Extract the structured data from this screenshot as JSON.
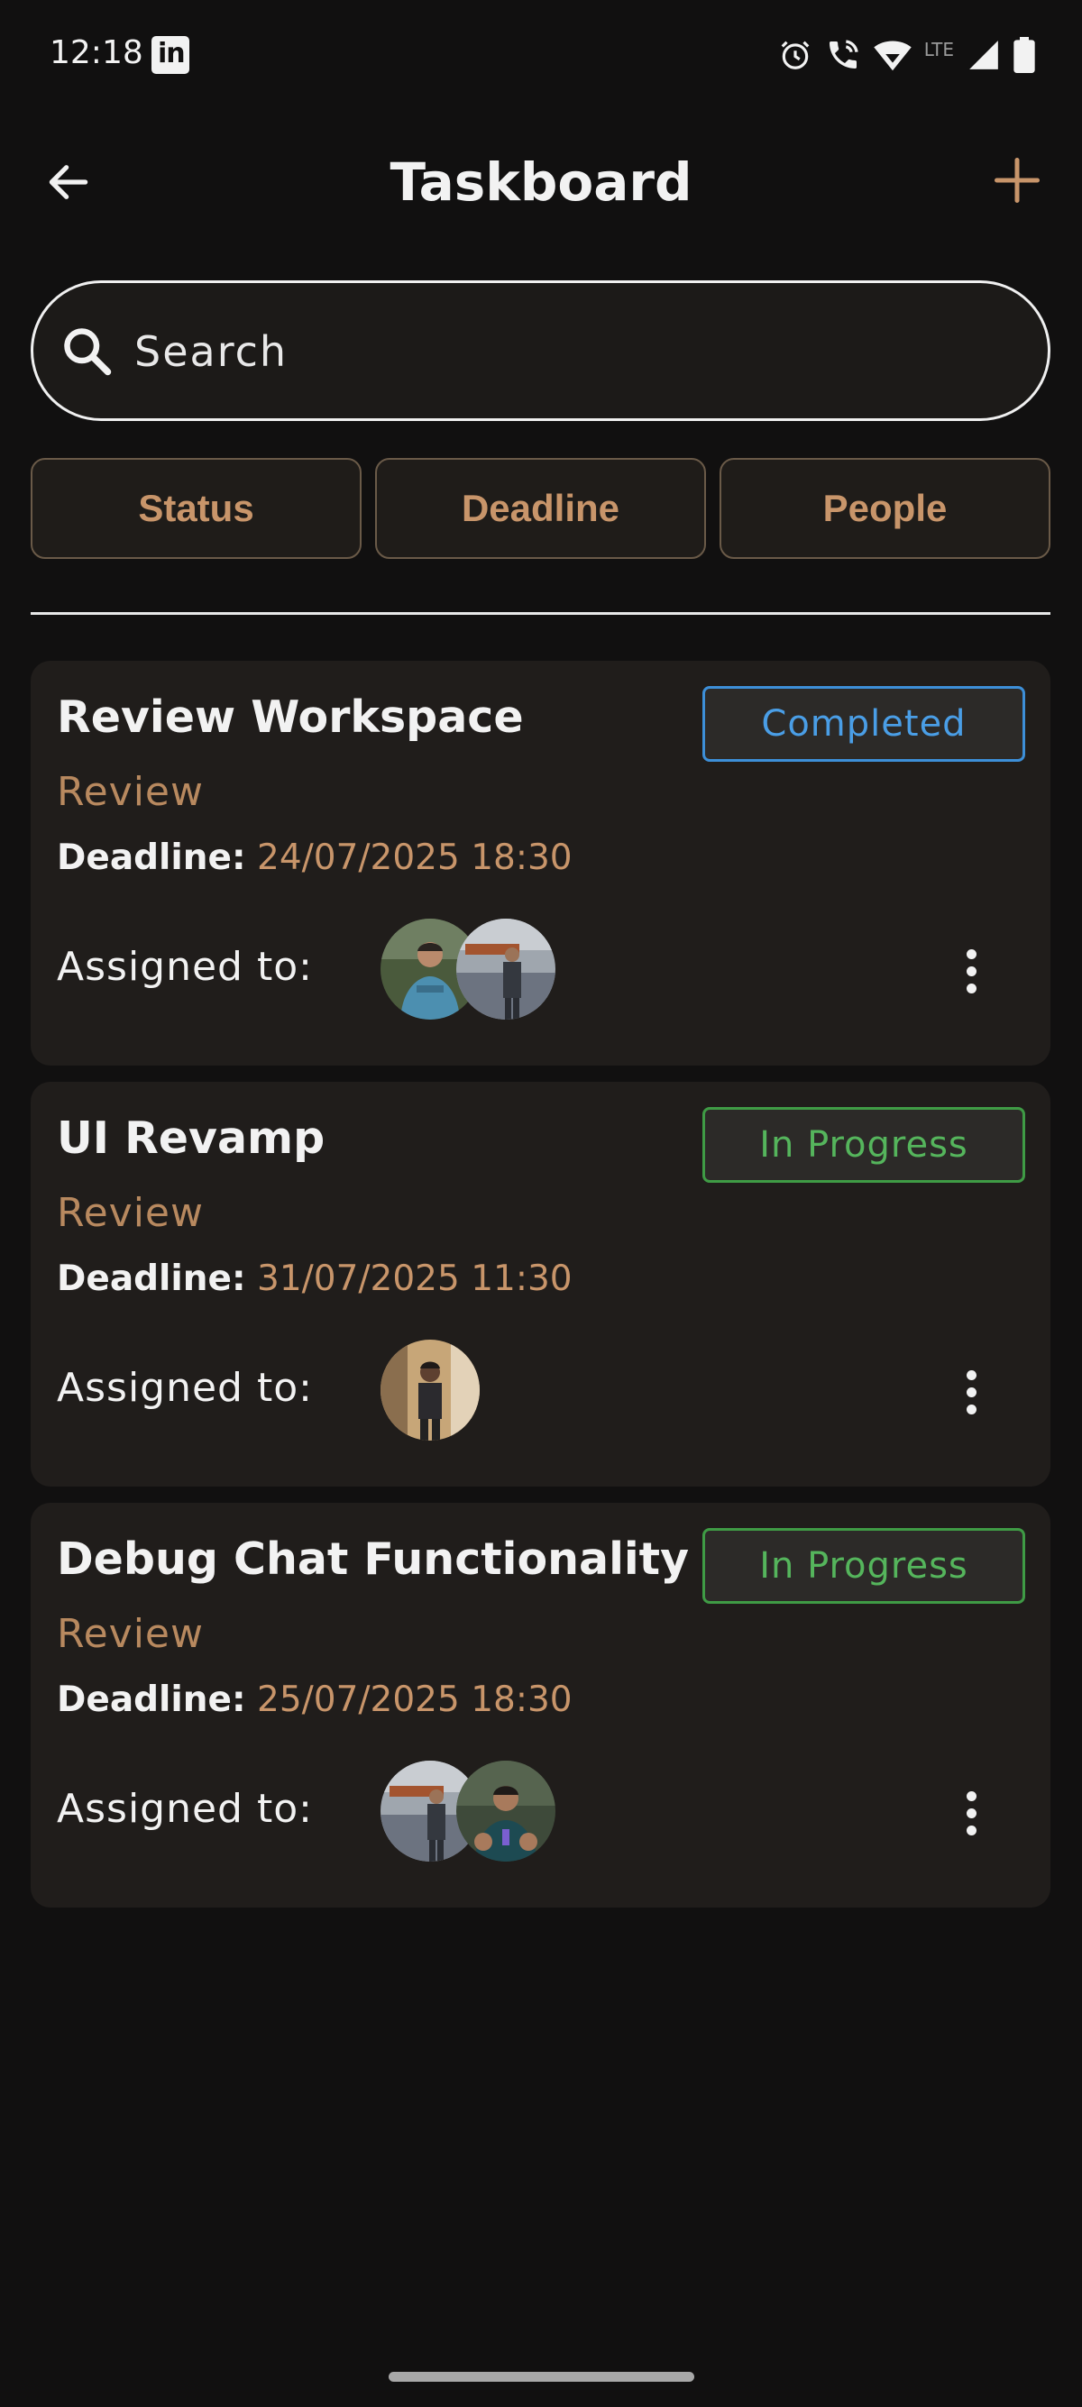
{
  "status_bar": {
    "time": "12:18",
    "lte": "LTE"
  },
  "header": {
    "title": "Taskboard",
    "back_icon": "arrow-left-icon",
    "add_icon": "plus-icon"
  },
  "search": {
    "placeholder": "Search"
  },
  "filters": {
    "status": "Status",
    "deadline": "Deadline",
    "people": "People"
  },
  "tasks": [
    {
      "title": "Review Workspace",
      "status": "Completed",
      "category": "Review",
      "deadline_label": "Deadline:",
      "deadline": "24/07/2025 18:30",
      "assigned_label": "Assigned to:"
    },
    {
      "title": "UI Revamp",
      "status": "In Progress",
      "category": "Review",
      "deadline_label": "Deadline:",
      "deadline": "31/07/2025 11:30",
      "assigned_label": "Assigned to:"
    },
    {
      "title": "Debug Chat Functionality",
      "status": "In Progress",
      "category": "Review",
      "deadline_label": "Deadline:",
      "deadline": "25/07/2025 18:30",
      "assigned_label": "Assigned to:"
    }
  ],
  "colors": {
    "background": "#111010",
    "card": "#201d1b",
    "accent": "#c8956a",
    "completed": "#4a9ee6",
    "in_progress": "#55b55c"
  }
}
